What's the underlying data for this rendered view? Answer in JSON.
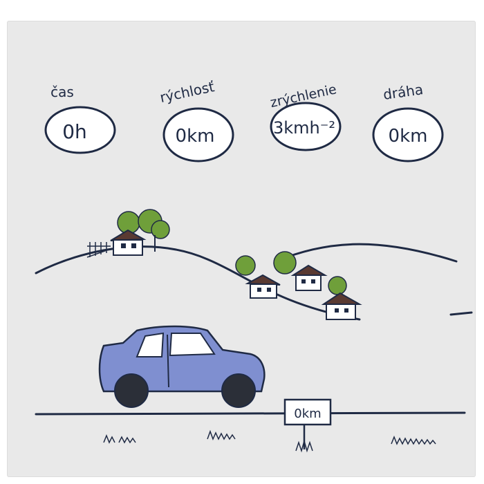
{
  "gauges": [
    {
      "label": "čas",
      "value": "0h"
    },
    {
      "label": "rýchlosť",
      "value": "0km"
    },
    {
      "label": "zrýchlenie",
      "value": "3kmh⁻²"
    },
    {
      "label": "dráha",
      "value": "0km"
    }
  ],
  "road_sign": {
    "value": "0km"
  },
  "colors": {
    "ink": "#1f2a44",
    "paper": "#e9e9e9",
    "car_body": "#7f8fd0",
    "wheel": "#2b2f38",
    "tree": "#6f9f3a",
    "roof": "#5a3a32"
  }
}
